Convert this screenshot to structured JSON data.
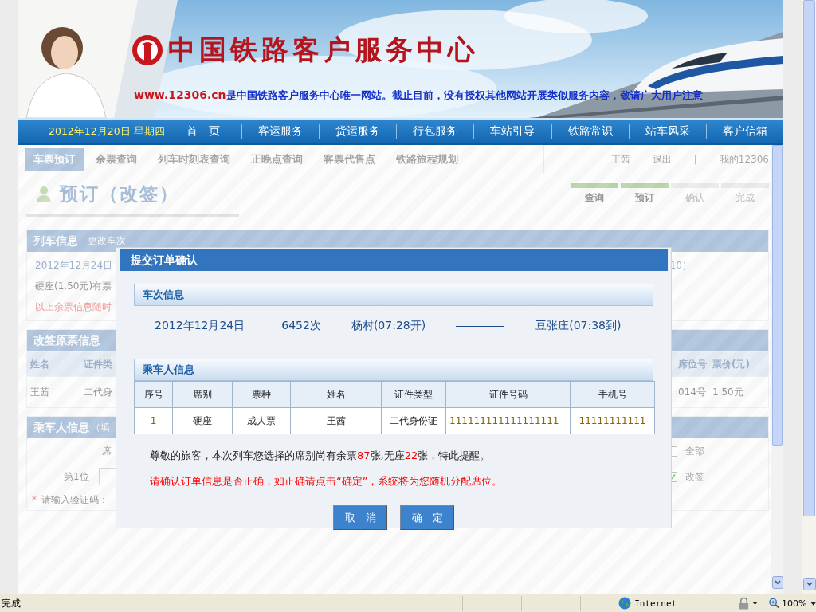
{
  "header": {
    "logo_text": "中国铁路客户服务中心",
    "notice": {
      "site": "www.12306.cn",
      "text": "是中国铁路客户服务中心唯一网站。截止目前，没有授权其他网站开展类似服务内容，敬请广大用户注意"
    }
  },
  "nav": {
    "date": "2012年12月20日  星期四",
    "items": [
      {
        "label": "首　页"
      },
      {
        "label": "客运服务"
      },
      {
        "label": "货运服务"
      },
      {
        "label": "行包服务"
      },
      {
        "label": "车站引导"
      },
      {
        "label": "铁路常识"
      },
      {
        "label": "站车风采"
      },
      {
        "label": "客户信箱"
      }
    ]
  },
  "page": {
    "tabs": [
      {
        "label": "车票预订",
        "selected": true
      },
      {
        "label": "余票查询",
        "selected": false
      },
      {
        "label": "列车时刻表查询",
        "selected": false
      },
      {
        "label": "正晚点查询",
        "selected": false
      },
      {
        "label": "客票代售点",
        "selected": false
      },
      {
        "label": "铁路旅程规划",
        "selected": false
      }
    ],
    "user": {
      "name": "王茜",
      "logout": "退出",
      "separator": "|",
      "account": "我的12306"
    },
    "title": "预订（改签）",
    "steps": [
      {
        "label": "查询",
        "done": true
      },
      {
        "label": "预订",
        "done": true
      },
      {
        "label": "确认",
        "done": false
      },
      {
        "label": "完成",
        "done": false
      }
    ],
    "train_section": {
      "title": "列车信息",
      "link": "更改车次",
      "date": "2012年12月24日",
      "time_tail": "10）",
      "seat": "硬座(1.50元)有票",
      "warning": "以上余票信息随时"
    },
    "original_ticket": {
      "title": "改签原票信息",
      "columns": [
        "姓名",
        "证件类",
        "席位号",
        "票价(元)"
      ],
      "row": [
        "王茜",
        "二代身",
        "014号",
        "1.50元"
      ]
    },
    "passenger_section": {
      "title": "乘车人信息",
      "note": "（填",
      "seat_label": "席",
      "all": {
        "label": "全部",
        "checked": false
      },
      "position": "第1位",
      "change": {
        "label": "改签",
        "checked": true
      },
      "required_mark": "*",
      "captcha": "请输入验证码："
    }
  },
  "dialog": {
    "title": "提交订单确认",
    "train_title": "车次信息",
    "train": {
      "date": "2012年12月24日",
      "number": "6452次",
      "from": "杨村(07:28开)",
      "to": "豆张庄(07:38到)"
    },
    "passenger_title": "乘车人信息",
    "columns": [
      "序号",
      "席别",
      "票种",
      "姓名",
      "证件类型",
      "证件号码",
      "手机号"
    ],
    "rows": [
      [
        "1",
        "硬座",
        "成人票",
        "王茜",
        "二代身份证",
        "111111111111111111",
        "11111111111"
      ]
    ],
    "message": [
      {
        "text": "尊敬的旅客，本次列车您选择的席别尚有余票",
        "highlight": false
      },
      {
        "text": "87",
        "highlight": true
      },
      {
        "text": "张,无座",
        "highlight": false
      },
      {
        "text": "22",
        "highlight": true
      },
      {
        "text": "张，特此提醒。",
        "highlight": false
      }
    ],
    "confirm_note": "请确认订单信息是否正确，如正确请点击“确定”，系统将为您随机分配席位。",
    "buttons": [
      {
        "label": "取　消"
      },
      {
        "label": "确　定"
      }
    ]
  },
  "status_bar": {
    "status": "完成",
    "zone": "Internet",
    "zoom": "100%"
  }
}
